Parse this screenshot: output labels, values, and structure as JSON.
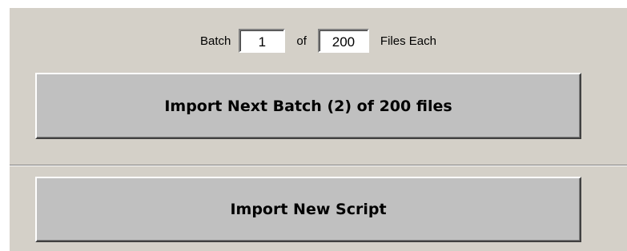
{
  "batch_row": {
    "batch_label": "Batch",
    "batch_value": "1",
    "of_label": "of",
    "files_per_batch_value": "200",
    "files_each_label": "Files Each"
  },
  "buttons": {
    "import_next_batch_label": "Import Next Batch (2) of 200 files",
    "import_new_script_label": "Import New Script"
  },
  "colors": {
    "panel_background": "#d4d0c8",
    "button_face": "#c0c0c0",
    "field_background": "#ffffff"
  }
}
